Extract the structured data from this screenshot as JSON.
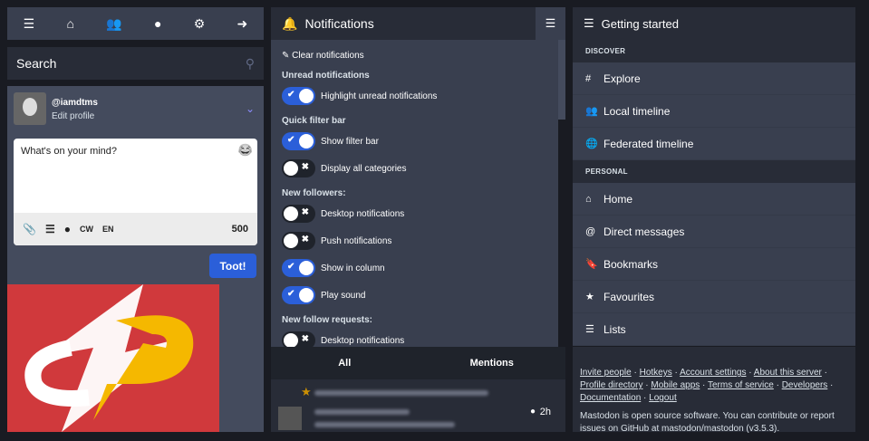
{
  "nav": {
    "icons": [
      "menu-icon",
      "home-icon",
      "users-icon",
      "globe-icon",
      "gear-icon",
      "logout-icon"
    ]
  },
  "search": {
    "placeholder": "Search"
  },
  "profile": {
    "handle": "@iamdtms",
    "edit": "Edit profile"
  },
  "compose": {
    "placeholder": "What's on your mind?",
    "cw": "CW",
    "lang": "EN",
    "count": "500",
    "toot": "Toot!"
  },
  "notifications": {
    "title": "Notifications",
    "clear": "Clear notifications",
    "sections": [
      {
        "heading": "Unread notifications",
        "items": [
          {
            "label": "Highlight unread notifications",
            "on": true
          }
        ]
      },
      {
        "heading": "Quick filter bar",
        "items": [
          {
            "label": "Show filter bar",
            "on": true
          },
          {
            "label": "Display all categories",
            "on": false
          }
        ]
      },
      {
        "heading": "New followers:",
        "items": [
          {
            "label": "Desktop notifications",
            "on": false
          },
          {
            "label": "Push notifications",
            "on": false
          },
          {
            "label": "Show in column",
            "on": true
          },
          {
            "label": "Play sound",
            "on": true
          }
        ]
      },
      {
        "heading": "New follow requests:",
        "items": [
          {
            "label": "Desktop notifications",
            "on": false
          }
        ]
      }
    ],
    "tabs": [
      "All",
      "Mentions"
    ],
    "time": "2h"
  },
  "getting_started": {
    "title": "Getting started",
    "discover": "DISCOVER",
    "personal": "PERSONAL",
    "discover_items": [
      {
        "icon": "#",
        "label": "Explore"
      },
      {
        "icon": "👥",
        "label": "Local timeline"
      },
      {
        "icon": "🌐",
        "label": "Federated timeline"
      }
    ],
    "personal_items": [
      {
        "icon": "⌂",
        "label": "Home"
      },
      {
        "icon": "@",
        "label": "Direct messages"
      },
      {
        "icon": "🔖",
        "label": "Bookmarks"
      },
      {
        "icon": "★",
        "label": "Favourites"
      },
      {
        "icon": "☰",
        "label": "Lists"
      }
    ],
    "links": [
      "Invite people",
      "Hotkeys",
      "Account settings",
      "About this server",
      "Profile directory",
      "Mobile apps",
      "Terms of service",
      "Developers",
      "Documentation",
      "Logout"
    ],
    "about": "Mastodon is open source software. You can contribute or report issues on GitHub at mastodon/mastodon (v3.5.3)."
  }
}
